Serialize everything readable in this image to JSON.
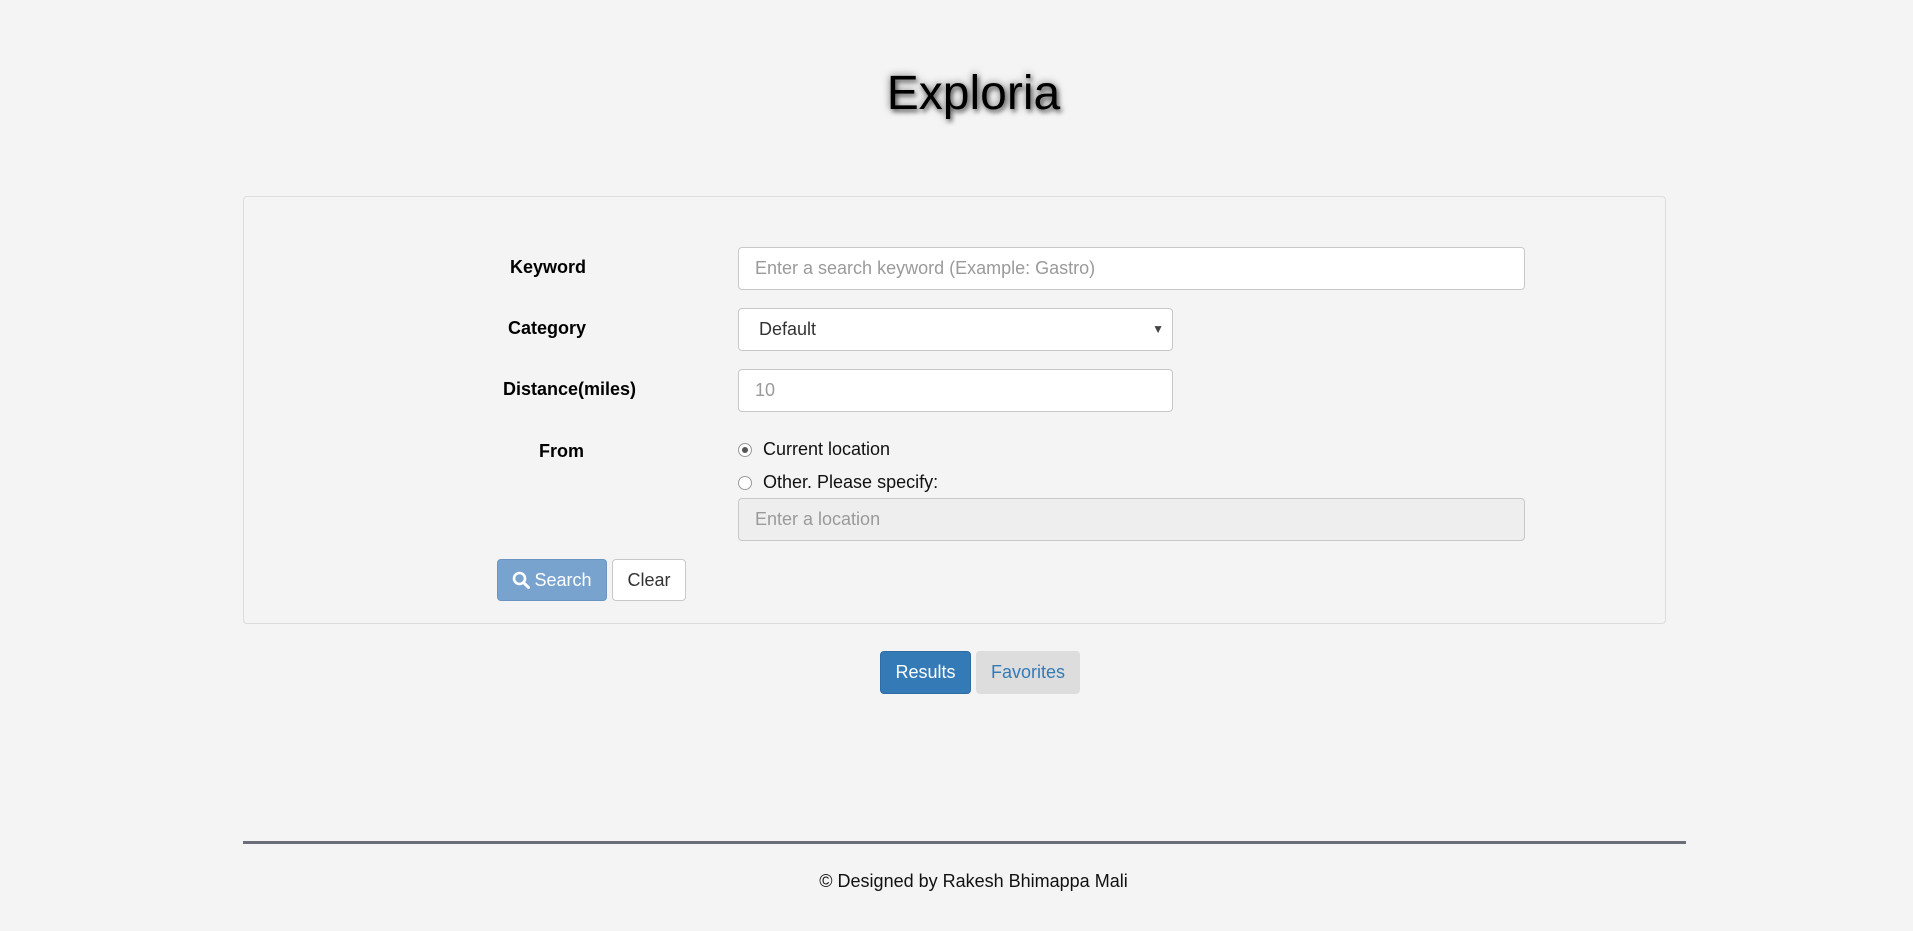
{
  "app": {
    "title": "Exploria"
  },
  "form": {
    "keyword": {
      "label": "Keyword",
      "placeholder": "Enter a search keyword (Example: Gastro)"
    },
    "category": {
      "label": "Category",
      "selected": "Default"
    },
    "distance": {
      "label": "Distance(miles)",
      "placeholder": "10"
    },
    "from": {
      "label": "From",
      "options": [
        {
          "label": "Current location",
          "checked": true
        },
        {
          "label": "Other. Please specify:",
          "checked": false
        }
      ],
      "location_placeholder": "Enter a location"
    },
    "buttons": {
      "search": "Search",
      "clear": "Clear"
    }
  },
  "tabs": {
    "results": "Results",
    "favorites": "Favorites"
  },
  "footer": {
    "text": "© Designed by Rakesh Bhimappa Mali"
  },
  "colors": {
    "primary": "#337ab7",
    "search_button": "#79a3cf",
    "background": "#f4f4f4"
  },
  "icons": {
    "search": "search-icon",
    "dropdown": "caret-down-icon"
  }
}
